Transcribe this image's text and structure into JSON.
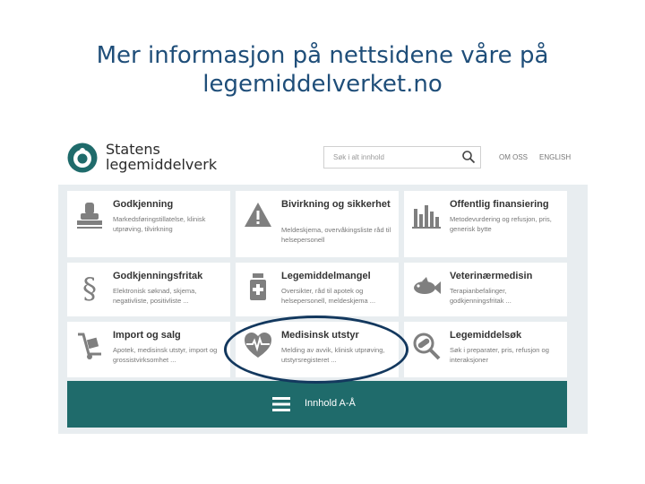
{
  "slide": {
    "title": "Mer informasjon på nettsidene våre på legemiddelverket.no"
  },
  "header": {
    "logo_line1": "Statens",
    "logo_line2": "legemiddelverk",
    "search_placeholder": "Søk i alt innhold",
    "link_about": "OM OSS",
    "link_english": "ENGLISH"
  },
  "tiles": [
    {
      "title": "Godkjenning",
      "desc": "Markedsføringstillatelse, klinisk utprøving, tilvirkning",
      "icon": "stamp-icon"
    },
    {
      "title": "Bivirkning og sikkerhet",
      "desc": "Meldeskjema, overvåkingsliste råd til helsepersonell",
      "icon": "warning-icon"
    },
    {
      "title": "Offentlig finansiering",
      "desc": "Metodevurdering og refusjon, pris, generisk bytte",
      "icon": "bar-chart-icon"
    },
    {
      "title": "Godkjenningsfritak",
      "desc": "Elektronisk søknad, skjema, negativliste, positivliste ...",
      "icon": "paragraph-icon"
    },
    {
      "title": "Legemiddelmangel",
      "desc": "Oversikter, råd til apotek og helsepersonell, meldeskjema ...",
      "icon": "medicine-bottle-icon"
    },
    {
      "title": "Veterinærmedisin",
      "desc": "Terapianbefalinger, godkjenningsfritak ...",
      "icon": "fish-icon"
    },
    {
      "title": "Import og salg",
      "desc": "Apotek, medisinsk utstyr, import og grossistvirksomhet ...",
      "icon": "hand-truck-icon"
    },
    {
      "title": "Medisinsk utstyr",
      "desc": "Melding av avvik, klinisk utprøving, utstyrsregisteret ...",
      "icon": "heart-pulse-icon"
    },
    {
      "title": "Legemiddelsøk",
      "desc": "Søk i preparater, pris, refusjon og interaksjoner",
      "icon": "pill-search-icon"
    }
  ],
  "bottom": {
    "label": "Innhold A-Å",
    "icon": "menu-icon"
  },
  "colors": {
    "teal": "#1f6b6b",
    "title_blue": "#1f4e79",
    "ring": "#13385e",
    "icon_gray": "#7f7f7f"
  }
}
